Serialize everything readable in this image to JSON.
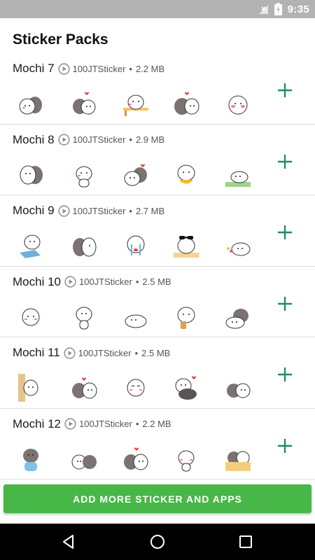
{
  "status_bar": {
    "time": "9:35",
    "icons": [
      "no-signal-icon",
      "battery-charging-icon"
    ]
  },
  "app_title": "Sticker Packs",
  "packs": [
    {
      "name": "Mochi 7",
      "author": "100JTSticker",
      "separator": "•",
      "size": "2.2 MB"
    },
    {
      "name": "Mochi 8",
      "author": "100JTSticker",
      "separator": "•",
      "size": "2.9 MB"
    },
    {
      "name": "Mochi 9",
      "author": "100JTSticker",
      "separator": "•",
      "size": "2.7 MB"
    },
    {
      "name": "Mochi 10",
      "author": "100JTSticker",
      "separator": "•",
      "size": "2.5 MB"
    },
    {
      "name": "Mochi 11",
      "author": "100JTSticker",
      "separator": "•",
      "size": "2.5 MB"
    },
    {
      "name": "Mochi 12",
      "author": "100JTSticker",
      "separator": "•",
      "size": "2.2 MB"
    }
  ],
  "cta_label": "ADD MORE STICKER AND APPS",
  "colors": {
    "accent_green": "#47b748",
    "add_icon_teal": "#1f8a6e",
    "status_bar": "#b3b3b3"
  },
  "nav": {
    "icons": [
      "back-icon",
      "home-icon",
      "recents-icon"
    ]
  }
}
